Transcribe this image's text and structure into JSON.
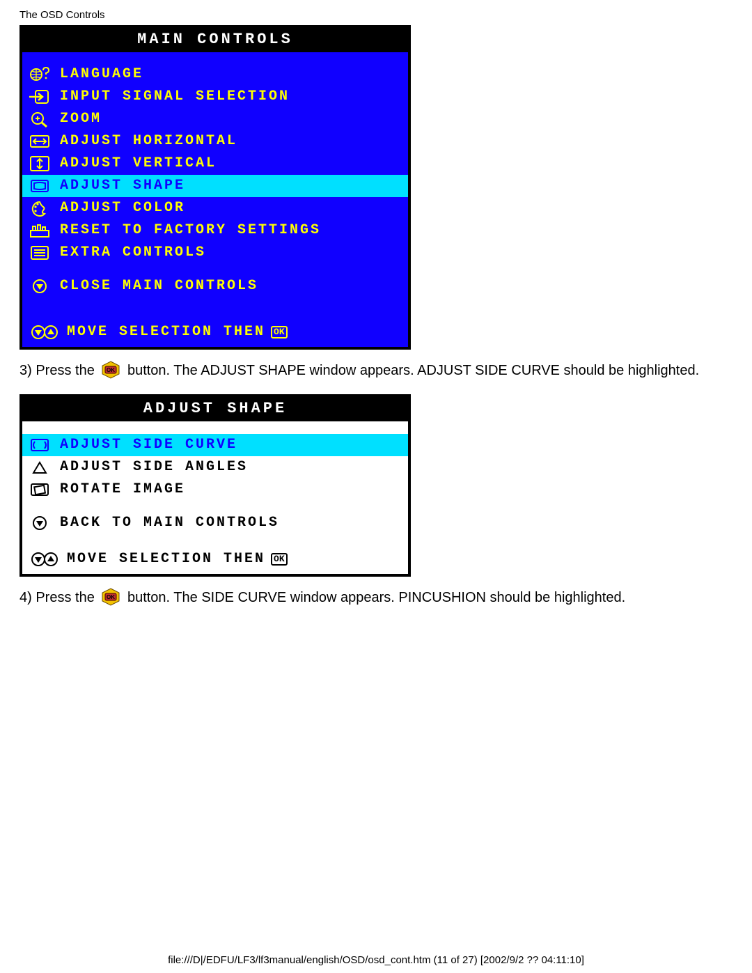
{
  "page_title": "The OSD Controls",
  "main": {
    "title": "MAIN CONTROLS",
    "items": [
      {
        "icon": "globe-question-icon",
        "label": "LANGUAGE",
        "highlight": false
      },
      {
        "icon": "input-arrow-icon",
        "label": "INPUT SIGNAL SELECTION",
        "highlight": false
      },
      {
        "icon": "zoom-icon",
        "label": "ZOOM",
        "highlight": false
      },
      {
        "icon": "adjust-horiz-icon",
        "label": "ADJUST HORIZONTAL",
        "highlight": false
      },
      {
        "icon": "adjust-vert-icon",
        "label": "ADJUST VERTICAL",
        "highlight": false
      },
      {
        "icon": "adjust-shape-icon",
        "label": "ADJUST SHAPE",
        "highlight": true
      },
      {
        "icon": "adjust-color-icon",
        "label": "ADJUST COLOR",
        "highlight": false
      },
      {
        "icon": "factory-reset-icon",
        "label": "RESET TO FACTORY SETTINGS",
        "highlight": false
      },
      {
        "icon": "extra-controls-icon",
        "label": "EXTRA CONTROLS",
        "highlight": false
      }
    ],
    "close": {
      "icon": "down-circle-icon",
      "label": "CLOSE MAIN CONTROLS"
    },
    "footer": {
      "icon": "up-down-circles-icon",
      "label": "MOVE SELECTION THEN",
      "ok": "OK"
    }
  },
  "step3": {
    "prefix": "3) Press the ",
    "suffix": " button. The ADJUST SHAPE window appears. ADJUST SIDE CURVE should be highlighted."
  },
  "shape": {
    "title": "ADJUST SHAPE",
    "items": [
      {
        "icon": "side-curve-icon",
        "label": "ADJUST SIDE CURVE",
        "highlight": true
      },
      {
        "icon": "side-angles-icon",
        "label": "ADJUST SIDE ANGLES",
        "highlight": false
      },
      {
        "icon": "rotate-image-icon",
        "label": "ROTATE IMAGE",
        "highlight": false
      }
    ],
    "back": {
      "icon": "down-circle-icon",
      "label": "BACK TO MAIN CONTROLS"
    },
    "footer": {
      "icon": "up-down-circles-icon",
      "label": "MOVE SELECTION THEN",
      "ok": "OK"
    }
  },
  "step4": {
    "prefix": "4) Press the ",
    "suffix": " button. The SIDE CURVE window appears. PINCUSHION should be highlighted."
  },
  "footer_path": "file:///D|/EDFU/LF3/lf3manual/english/OSD/osd_cont.htm (11 of 27) [2002/9/2 ?? 04:11:10]"
}
